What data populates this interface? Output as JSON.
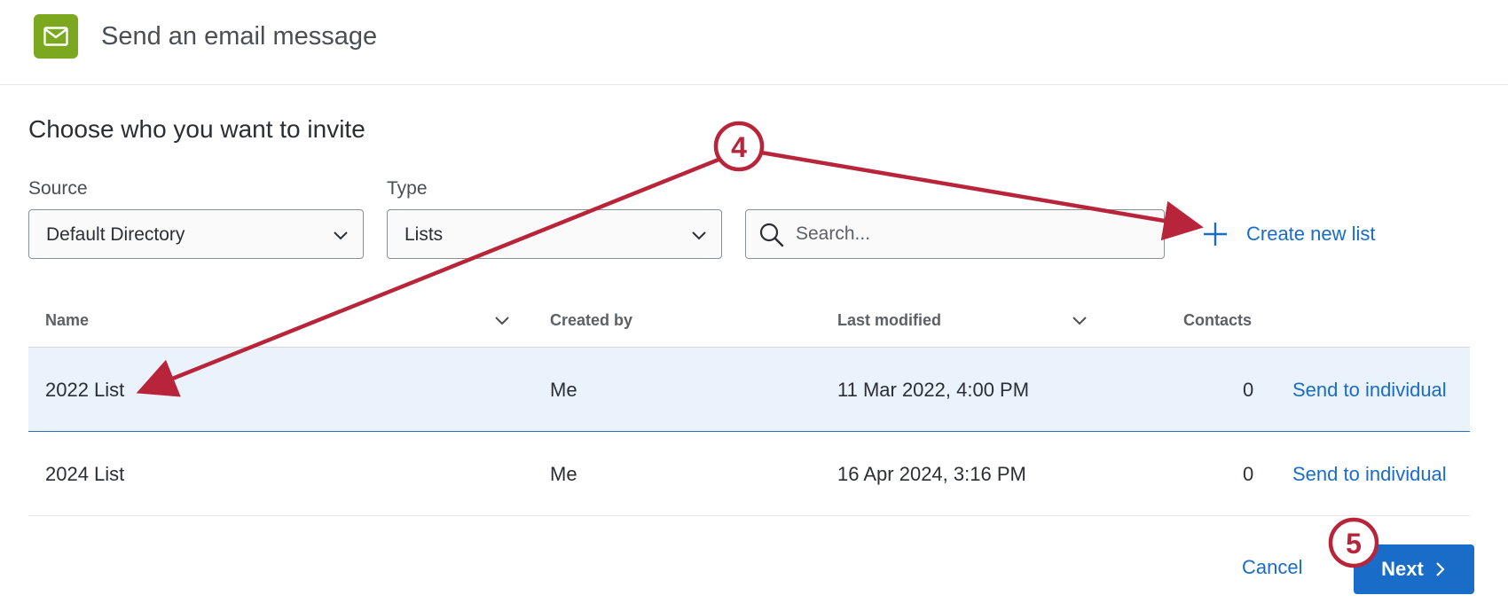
{
  "header": {
    "title": "Send an email message",
    "icon": "mail-icon",
    "icon_color": "#7ba81f"
  },
  "section": {
    "title": "Choose who you want to invite"
  },
  "filters": {
    "source": {
      "label": "Source",
      "value": "Default Directory"
    },
    "type": {
      "label": "Type",
      "value": "Lists"
    },
    "search": {
      "placeholder": "Search..."
    },
    "create_list": "Create new list"
  },
  "table": {
    "headers": {
      "name": "Name",
      "created_by": "Created by",
      "last_modified": "Last modified",
      "contacts": "Contacts"
    },
    "rows": [
      {
        "name": "2022 List",
        "created_by": "Me",
        "last_modified": "11 Mar 2022, 4:00 PM",
        "contacts": "0",
        "action": "Send to individual",
        "selected": true
      },
      {
        "name": "2024 List",
        "created_by": "Me",
        "last_modified": "16 Apr 2024, 3:16 PM",
        "contacts": "0",
        "action": "Send to individual",
        "selected": false
      }
    ]
  },
  "footer": {
    "cancel": "Cancel",
    "next": "Next"
  },
  "annotations": {
    "step_a": "4",
    "step_b": "5",
    "color": "#b8253a"
  },
  "colors": {
    "accent": "#1a6cc9",
    "selected_row": "#eaf2fb"
  }
}
